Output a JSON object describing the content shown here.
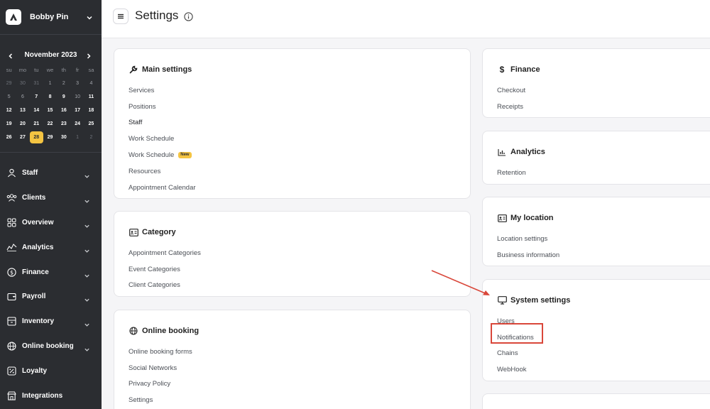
{
  "sidebar": {
    "user_name": "Bobby Pin",
    "calendar": {
      "month_label": "November 2023",
      "weekdays": [
        "su",
        "mo",
        "tu",
        "we",
        "th",
        "fr",
        "sa"
      ],
      "weeks": [
        [
          "29",
          "30",
          "31",
          "1",
          "2",
          "3",
          "4"
        ],
        [
          "5",
          "6",
          "7",
          "8",
          "9",
          "10",
          "11"
        ],
        [
          "12",
          "13",
          "14",
          "15",
          "16",
          "17",
          "18"
        ],
        [
          "19",
          "20",
          "21",
          "22",
          "23",
          "24",
          "25"
        ],
        [
          "26",
          "27",
          "28",
          "29",
          "30",
          "1",
          "2"
        ]
      ],
      "selected_day": "28"
    },
    "nav": [
      {
        "label": "Staff",
        "icon": "person-icon",
        "expandable": true
      },
      {
        "label": "Clients",
        "icon": "clients-icon",
        "expandable": true
      },
      {
        "label": "Overview",
        "icon": "grid-icon",
        "expandable": true
      },
      {
        "label": "Analytics",
        "icon": "analytics-icon",
        "expandable": true
      },
      {
        "label": "Finance",
        "icon": "dollar-circle-icon",
        "expandable": true
      },
      {
        "label": "Payroll",
        "icon": "wallet-icon",
        "expandable": true
      },
      {
        "label": "Inventory",
        "icon": "box-icon",
        "expandable": true
      },
      {
        "label": "Online booking",
        "icon": "globe-icon",
        "expandable": true
      },
      {
        "label": "Loyalty",
        "icon": "percent-icon",
        "expandable": false
      },
      {
        "label": "Integrations",
        "icon": "store-icon",
        "expandable": false
      }
    ]
  },
  "header": {
    "title": "Settings"
  },
  "cards": {
    "main_settings": {
      "title": "Main settings",
      "links": [
        "Services",
        "Positions",
        "Staff",
        "Work Schedule",
        "Work Schedule",
        "Resources",
        "Appointment Calendar"
      ],
      "badge": "New"
    },
    "category": {
      "title": "Category",
      "links": [
        "Appointment Categories",
        "Event Categories",
        "Client Categories"
      ]
    },
    "online_booking": {
      "title": "Online booking",
      "links": [
        "Online booking forms",
        "Social Networks",
        "Privacy Policy",
        "Settings"
      ]
    },
    "finance": {
      "title": "Finance",
      "links": [
        "Checkout",
        "Receipts"
      ]
    },
    "analytics": {
      "title": "Analytics",
      "links": [
        "Retention"
      ]
    },
    "my_location": {
      "title": "My location",
      "links": [
        "Location settings",
        "Business information"
      ]
    },
    "system_settings": {
      "title": "System settings",
      "links": [
        "Users",
        "Notifications",
        "Chains",
        "WebHook"
      ]
    }
  },
  "colors": {
    "sidebar_bg": "#2b2d31",
    "accent": "#f4c442",
    "highlight": "#d9473a"
  }
}
